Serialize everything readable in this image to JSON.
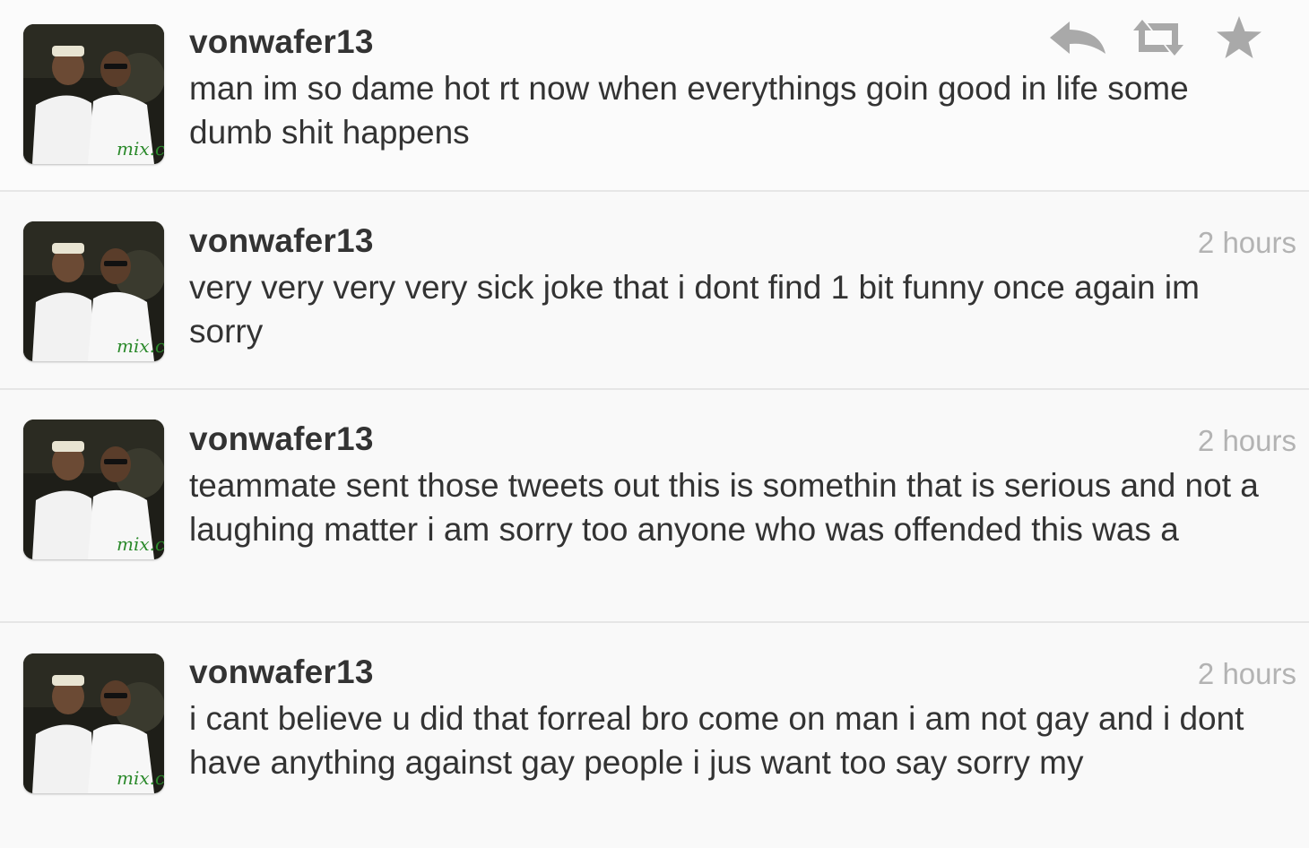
{
  "tweets": [
    {
      "username": "vonwafer13",
      "time": "",
      "text": "man im so dame hot rt now when everythings goin good in life some dumb shit happens",
      "actions": [
        "reply-icon",
        "retweet-icon",
        "favorite-star-icon"
      ]
    },
    {
      "username": "vonwafer13",
      "time": "2 hours",
      "text": "very very very very sick joke that i dont find 1 bit funny once again im sorry"
    },
    {
      "username": "vonwafer13",
      "time": "2 hours",
      "text": "teammate sent those tweets out this is somethin that is serious and not a laughing matter i am sorry too anyone who was offended this was a"
    },
    {
      "username": "vonwafer13",
      "time": "2 hours",
      "text": "i cant believe u did that forreal bro come on man i am not gay and i dont have anything against gay people i jus want too say sorry my"
    }
  ],
  "colors": {
    "text": "#333333",
    "timestamp": "#b3b3b3",
    "icon": "#a9a9a9",
    "row_bg": "#f9f9f9",
    "divider": "#e6e6e6"
  }
}
